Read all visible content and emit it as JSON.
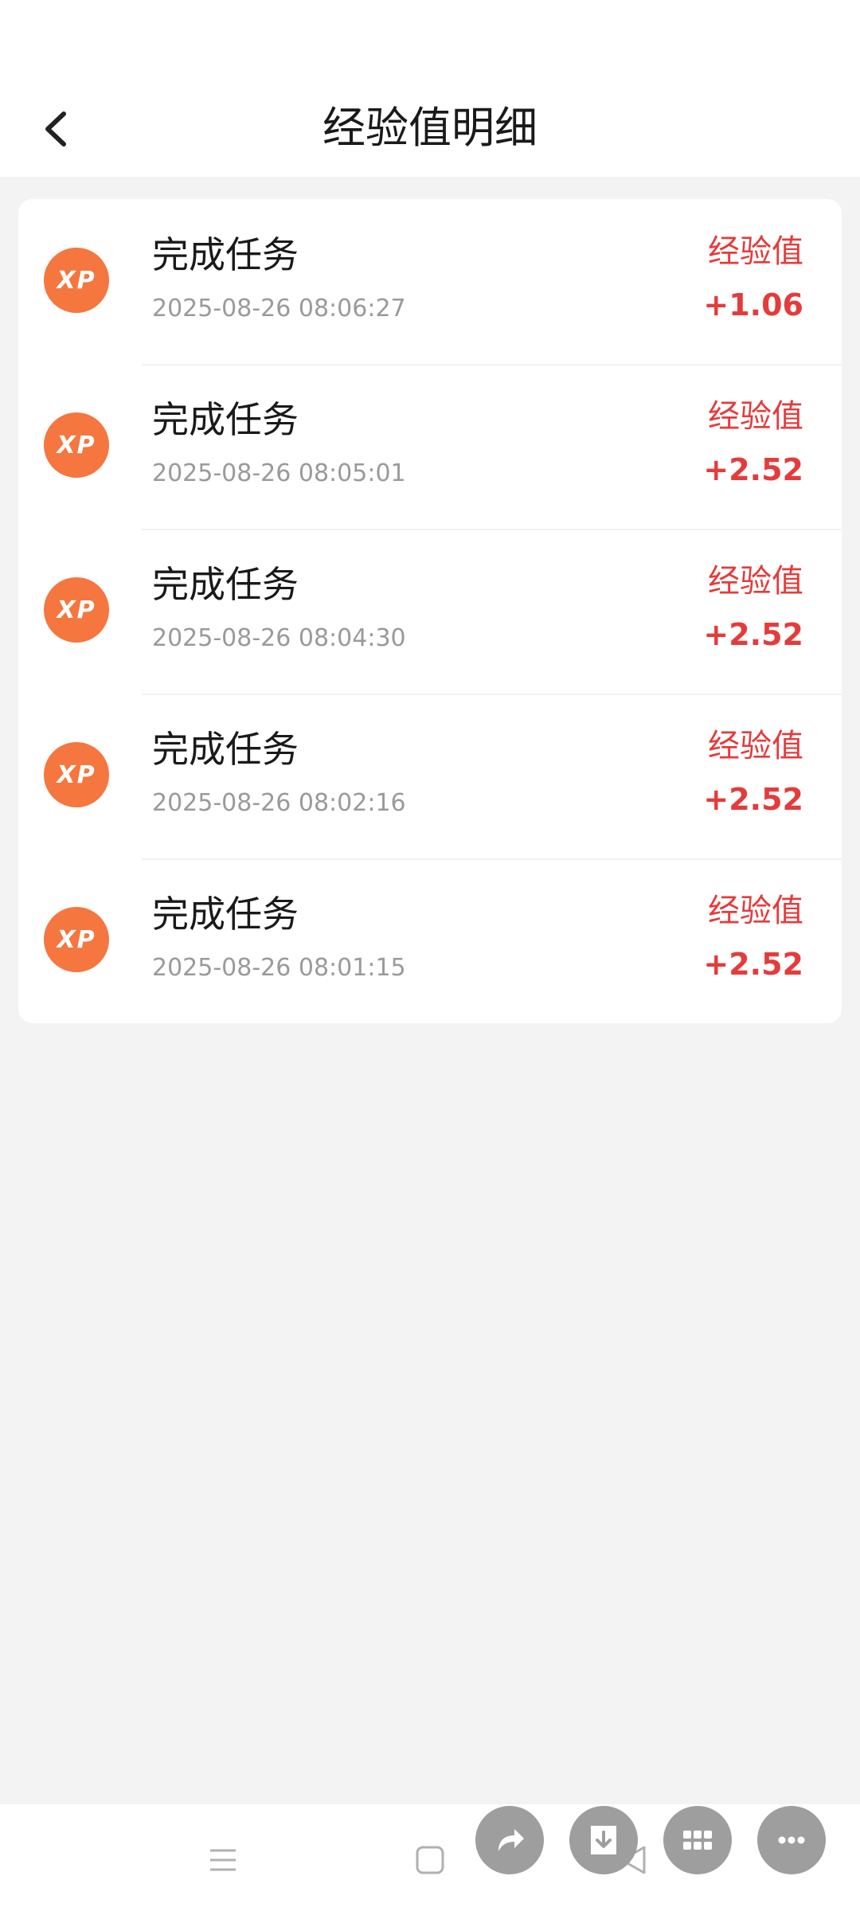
{
  "header": {
    "title": "经验值明细"
  },
  "records": [
    {
      "title": "完成任务",
      "time": "2025-08-26 08:06:27",
      "label": "经验值",
      "value": "+1.06",
      "icon_text": "XP"
    },
    {
      "title": "完成任务",
      "time": "2025-08-26 08:05:01",
      "label": "经验值",
      "value": "+2.52",
      "icon_text": "XP"
    },
    {
      "title": "完成任务",
      "time": "2025-08-26 08:04:30",
      "label": "经验值",
      "value": "+2.52",
      "icon_text": "XP"
    },
    {
      "title": "完成任务",
      "time": "2025-08-26 08:02:16",
      "label": "经验值",
      "value": "+2.52",
      "icon_text": "XP"
    },
    {
      "title": "完成任务",
      "time": "2025-08-26 08:01:15",
      "label": "经验值",
      "value": "+2.52",
      "icon_text": "XP"
    }
  ],
  "icons": {
    "back": "chevron-left-icon",
    "menu": "menu-icon",
    "home": "square-icon",
    "back_nav": "triangle-back-icon",
    "share": "share-arrow-icon",
    "download": "download-icon",
    "apps": "grid-icon",
    "more": "more-dots-icon"
  },
  "colors": {
    "accent": "#e53b3b",
    "xp_badge": "#f5763f",
    "background": "#f3f3f3",
    "fab": "#9e9e9e"
  }
}
